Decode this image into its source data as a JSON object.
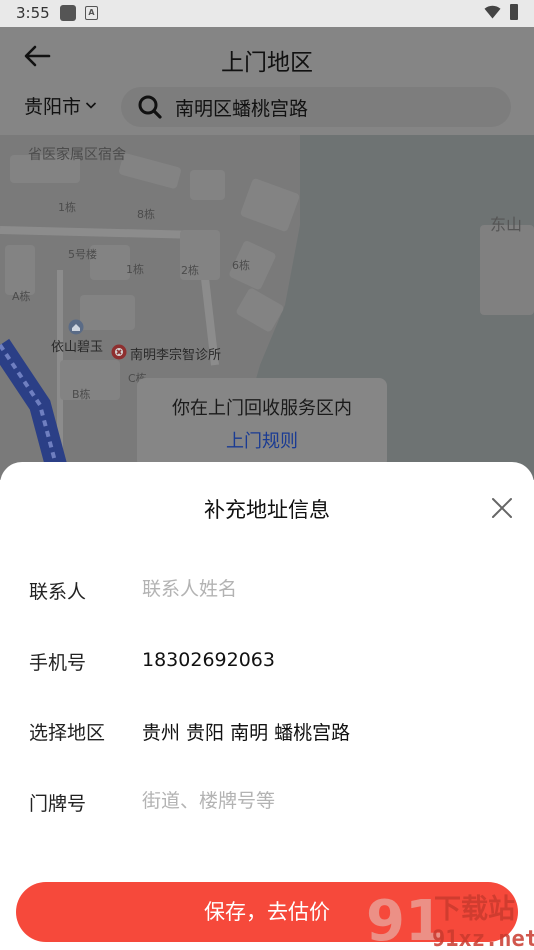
{
  "status_bar": {
    "time": "3:55",
    "notif_letter": "A"
  },
  "header": {
    "title": "上门地区",
    "city": "贵阳市",
    "search_query": "南明区蟠桃宫路"
  },
  "map": {
    "labels": {
      "top_estate": "省医家属区宿舍",
      "b1": "1栋",
      "b8": "8栋",
      "b5": "5号楼",
      "b1b": "1栋",
      "b2": "2栋",
      "b6": "6栋",
      "ba": "A栋",
      "bc": "C栋",
      "bb": "B栋",
      "east": "东山",
      "poi_yishan": "依山碧玉",
      "poi_clinic": "南明李宗智诊所"
    },
    "bubble": {
      "text": "你在上门回收服务区内",
      "link": "上门规则"
    }
  },
  "sheet": {
    "title": "补充地址信息",
    "fields": {
      "contact": {
        "label": "联系人",
        "placeholder": "联系人姓名",
        "value": ""
      },
      "phone": {
        "label": "手机号",
        "value": "18302692063"
      },
      "region": {
        "label": "选择地区",
        "value": "贵州 贵阳 南明 蟠桃宫路"
      },
      "door": {
        "label": "门牌号",
        "placeholder": "街道、楼牌号等",
        "value": ""
      }
    },
    "save_label": "保存，去估价"
  },
  "watermark": {
    "brand": "下载站",
    "url": "91xz.net",
    "digits": "91"
  },
  "colors": {
    "accent": "#f6493b",
    "link": "#1a3b93",
    "overlay": "#858585"
  },
  "icons": [
    "back-arrow-icon",
    "chevron-down-icon",
    "search-icon",
    "close-icon",
    "wifi-icon",
    "battery-icon"
  ]
}
